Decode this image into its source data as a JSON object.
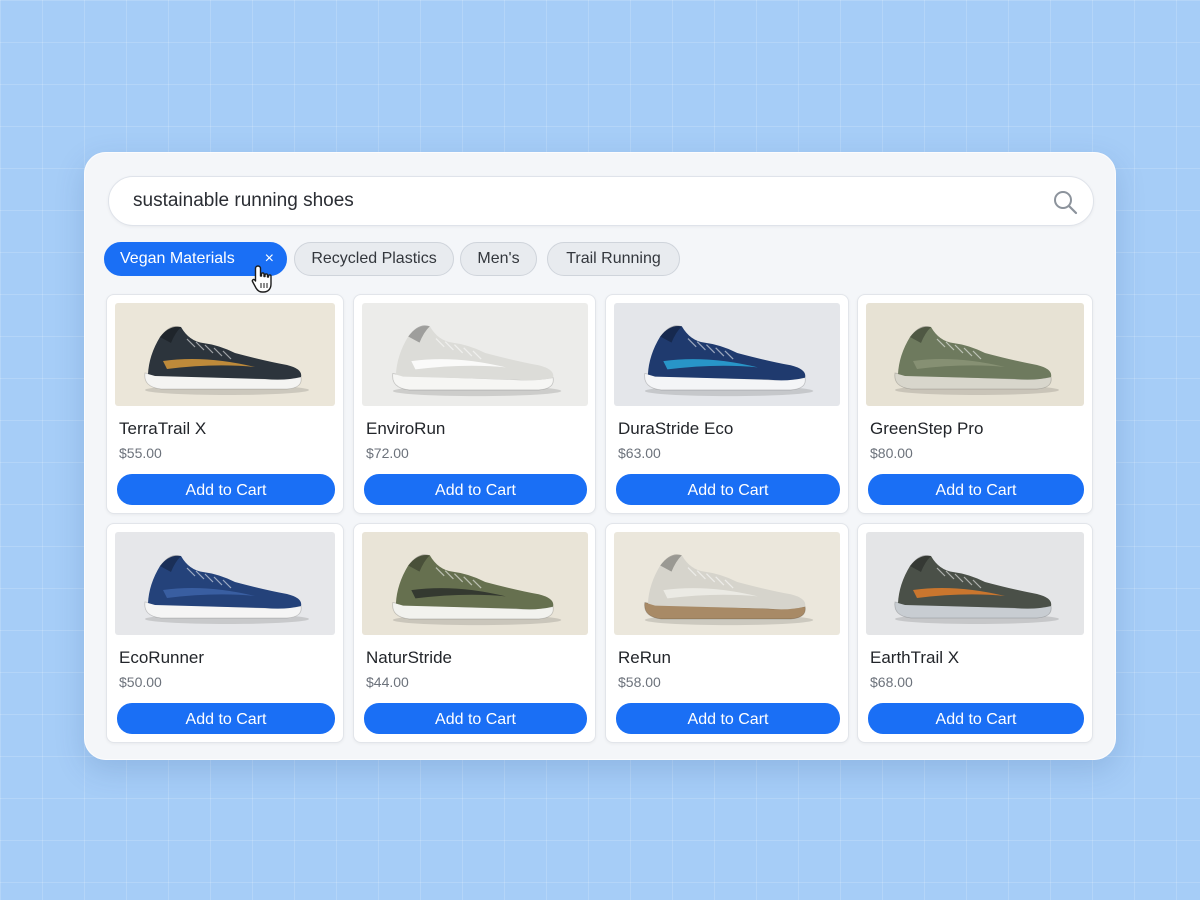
{
  "search": {
    "value": "sustainable running shoes",
    "icon": "search-icon"
  },
  "filters": [
    {
      "label": "Vegan Materials",
      "active": true,
      "remove_label": "×"
    },
    {
      "label": "Recycled Plastics",
      "active": false
    },
    {
      "label": "Men's",
      "active": false
    },
    {
      "label": "Trail Running",
      "active": false
    }
  ],
  "products": [
    {
      "name": "TerraTrail X",
      "price": "$55.00",
      "button": "Add to Cart",
      "image": {
        "bg": "#ebe6d9",
        "upper": "#2c343c",
        "accent": "#d89a3a",
        "sole": "#f4f4f2"
      }
    },
    {
      "name": "EnviroRun",
      "price": "$72.00",
      "button": "Add to Cart",
      "image": {
        "bg": "#ececea",
        "upper": "#dcdcd8",
        "accent": "#ffffff",
        "sole": "#f6f6f4"
      }
    },
    {
      "name": "DuraStride Eco",
      "price": "$63.00",
      "button": "Add to Cart",
      "image": {
        "bg": "#e4e6ea",
        "upper": "#1f3a6e",
        "accent": "#2aa6d8",
        "sole": "#f4f5f7"
      }
    },
    {
      "name": "GreenStep Pro",
      "price": "$80.00",
      "button": "Add to Cart",
      "image": {
        "bg": "#e7e2d4",
        "upper": "#6e7a5e",
        "accent": "#8b9477",
        "sole": "#d8d6cc"
      }
    },
    {
      "name": "EcoRunner",
      "price": "$50.00",
      "button": "Add to Cart",
      "image": {
        "bg": "#e6e7ea",
        "upper": "#24427a",
        "accent": "#3d63a8",
        "sole": "#f5f5f5"
      }
    },
    {
      "name": "NaturStride",
      "price": "$44.00",
      "button": "Add to Cart",
      "image": {
        "bg": "#e9e4d7",
        "upper": "#66704f",
        "accent": "#2b2f2a",
        "sole": "#f2f2ee"
      }
    },
    {
      "name": "ReRun",
      "price": "$58.00",
      "button": "Add to Cart",
      "image": {
        "bg": "#ebe7dc",
        "upper": "#d6d4cc",
        "accent": "#eeede8",
        "sole": "#a88a66"
      }
    },
    {
      "name": "EarthTrail X",
      "price": "$68.00",
      "button": "Add to Cart",
      "image": {
        "bg": "#e4e5e7",
        "upper": "#4a5048",
        "accent": "#e07d2a",
        "sole": "#c8cdd2"
      }
    }
  ],
  "colors": {
    "accent": "#1a6ff5",
    "background": "#a6cdf7",
    "panel": "#f4f6f9"
  }
}
